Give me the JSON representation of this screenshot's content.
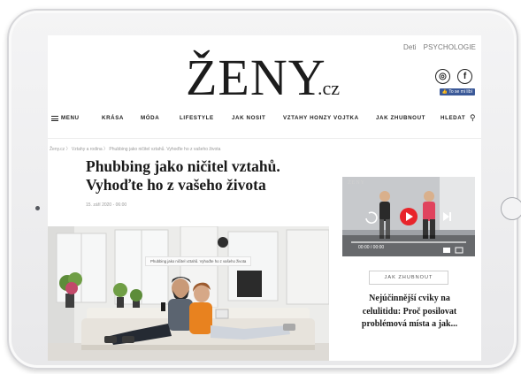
{
  "header": {
    "top_links": [
      "Deti",
      "PSYCHOLOGIE"
    ],
    "logo_main": "ŽENY",
    "logo_tld": ".cz",
    "social": {
      "instagram_glyph": "◎",
      "facebook_glyph": "f",
      "like_badge": "👍 To se mi líbí"
    }
  },
  "nav": {
    "menu_label": "MENU",
    "items": [
      "KRÁSA",
      "MÓDA",
      "LIFESTYLE",
      "JAK NOSIT",
      "VZTAHY HONZY VOJTKA",
      "JAK ZHUBNOUT"
    ],
    "search_label": "HLEDAT",
    "search_glyph": "🔍"
  },
  "breadcrumb": "Ženy.cz  〉 Vztahy a rodina  〉 Phubbing jako ničitel vztahů. Vyhoďte ho z vašeho života",
  "article": {
    "title": "Phubbing jako ničitel vztahů. Vyhoďte ho z vašeho života",
    "date": "15. září 2020 - 06:00",
    "image_caption": "Phubbing jako ničitel vztahů. Vyhoďte ho z vašeho života"
  },
  "sidebar": {
    "video_watermark": "ŽENY",
    "video_time": "00:00 / 00:00",
    "tag_label": "JAK ZHUBNOUT",
    "promo_title": "Nejúčinnější cviky na celulitidu: Proč posilovat problémová místa a jak..."
  },
  "colors": {
    "play_red": "#e8242a",
    "facebook_blue": "#3b5998",
    "shirt_orange": "#e8821f"
  }
}
